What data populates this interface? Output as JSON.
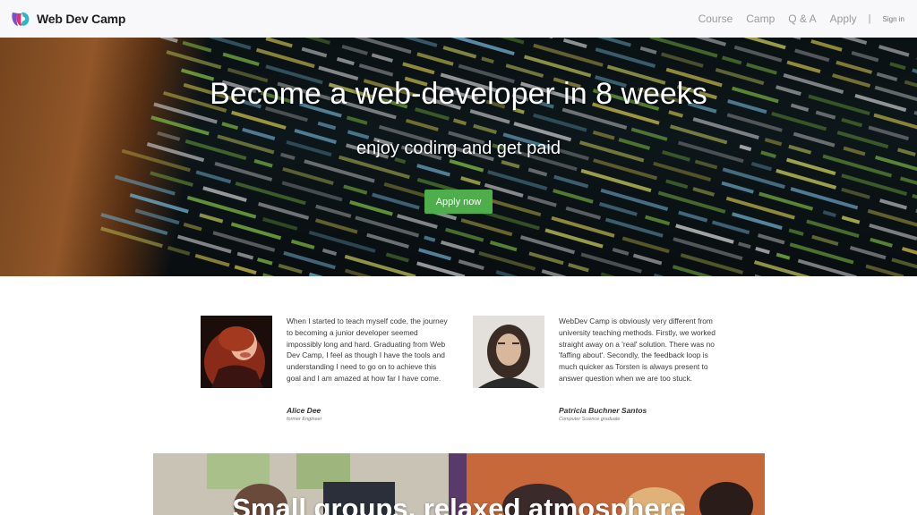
{
  "brand": {
    "name": "Web Dev Camp",
    "icon": "brand-logo-icon"
  },
  "nav": {
    "items": [
      "Course",
      "Camp",
      "Q & A",
      "Apply"
    ],
    "separator": "|",
    "signin": "Sign in"
  },
  "hero": {
    "title": "Become a web-developer in 8 weeks",
    "subtitle": "enjoy coding and get paid",
    "cta": "Apply now"
  },
  "testimonials": [
    {
      "text": "When I started to teach myself code, the journey to becoming a junior developer seemed impossibly long and hard. Graduating from Web Dev Camp, I feel as though I have the tools and understanding I need to go on to achieve this goal and I am amazed at how far I have come.",
      "name": "Alice Dee",
      "role": "former Engineer"
    },
    {
      "text": "WebDev Camp is obviously very different from university teaching methods. Firstly, we worked straight away on a 'real' solution. There was no 'faffing about'. Secondly, the feedback loop is much quicker as Torsten is always present to answer question when we are too stuck.",
      "name": "Patricia Buchner Santos",
      "role": "Computer Science graduate"
    }
  ],
  "banner": {
    "title": "Small groups, relaxed atmosphere"
  },
  "colors": {
    "cta_green": "#4eae4c",
    "nav_bg": "#f8f8fa",
    "nav_text": "#9a9a9a"
  }
}
